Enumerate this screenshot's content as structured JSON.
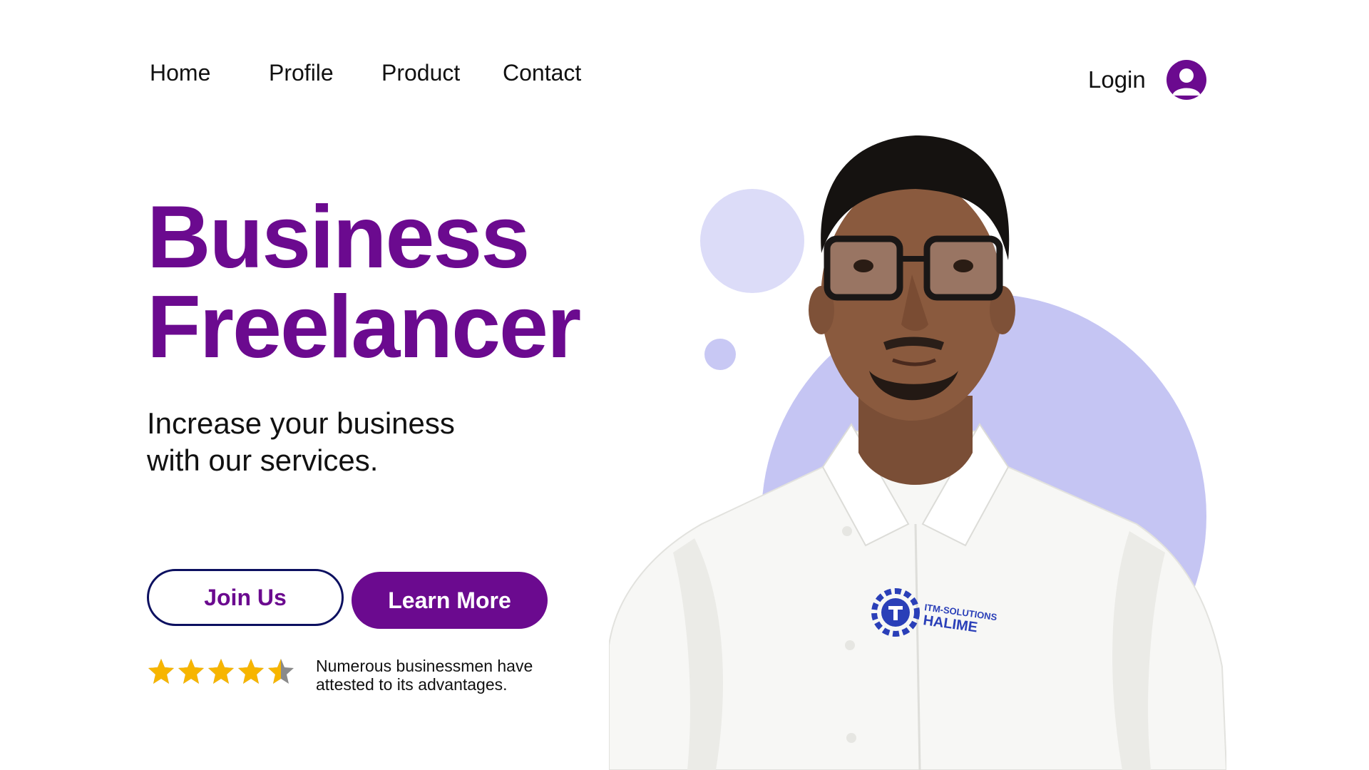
{
  "nav": {
    "items": [
      "Home",
      "Profile",
      "Product",
      "Contact"
    ],
    "login": "Login"
  },
  "hero": {
    "title_line1": "Business",
    "title_line2": "Freelancer",
    "subtitle_line1": "Increase your business",
    "subtitle_line2": "with our services."
  },
  "buttons": {
    "join": "Join Us",
    "learn": "Learn More"
  },
  "rating": {
    "stars_value": 4.5,
    "stars_max": 5,
    "text_line1": "Numerous businessmen have",
    "text_line2": "attested to its advantages."
  },
  "shirt_logo": {
    "line1": "ITM-SOLUTIONS",
    "line2": "HALIME"
  },
  "colors": {
    "brand_purple": "#6b0a8f",
    "button_border": "#0c1060",
    "circle_light": "#dcdcf8",
    "circle_main": "#c5c5f3",
    "star_gold": "#f7b500",
    "star_gray": "#8a8a8a"
  }
}
